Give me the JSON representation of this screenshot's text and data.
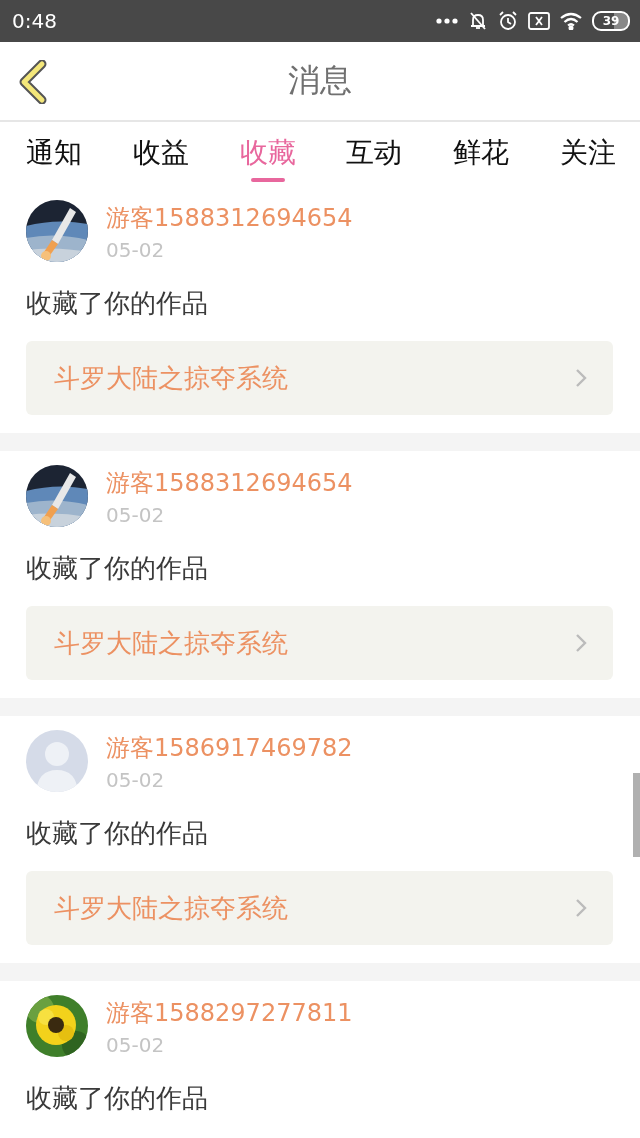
{
  "status_bar": {
    "time": "0:48",
    "battery": "39"
  },
  "header": {
    "title": "消息"
  },
  "tabs": [
    {
      "label": "通知",
      "selected": false
    },
    {
      "label": "收益",
      "selected": false
    },
    {
      "label": "收藏",
      "selected": true
    },
    {
      "label": "互动",
      "selected": false
    },
    {
      "label": "鲜花",
      "selected": false
    },
    {
      "label": "关注",
      "selected": false
    }
  ],
  "messages": [
    {
      "avatar": {
        "kind": "rocket"
      },
      "user": "游客1588312694654",
      "date": "05-02",
      "text": "收藏了你的作品",
      "work": "斗罗大陆之掠夺系统"
    },
    {
      "avatar": {
        "kind": "rocket"
      },
      "user": "游客1588312694654",
      "date": "05-02",
      "text": "收藏了你的作品",
      "work": "斗罗大陆之掠夺系统"
    },
    {
      "avatar": {
        "kind": "default"
      },
      "user": "游客1586917469782",
      "date": "05-02",
      "text": "收藏了你的作品",
      "work": "斗罗大陆之掠夺系统"
    },
    {
      "avatar": {
        "kind": "sunflower"
      },
      "user": "游客1588297277811",
      "date": "05-02",
      "text": "收藏了你的作品"
    }
  ]
}
